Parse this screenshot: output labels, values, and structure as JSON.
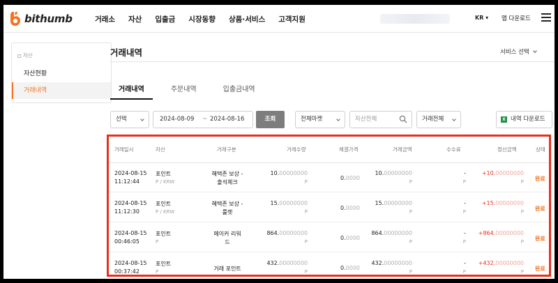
{
  "header": {
    "brand": "bithumb",
    "nav": [
      "거래소",
      "자산",
      "입출금",
      "시장동향",
      "상품·서비스",
      "고객지원"
    ],
    "lang": "KR ▾",
    "app_download": "앱 다운로드"
  },
  "colors": {
    "accent": "#f37321",
    "highlight_border": "#e5301d",
    "query_button": "#7d7d7d"
  },
  "sidebar": {
    "section": "자산",
    "items": [
      {
        "label": "자산현황",
        "active": false
      },
      {
        "label": "거래내역",
        "active": true
      }
    ]
  },
  "page": {
    "title": "거래내역",
    "service_select": "서비스 선택"
  },
  "tabs": [
    {
      "label": "거래내역",
      "active": true
    },
    {
      "label": "주문내역",
      "active": false
    },
    {
      "label": "입출금내역",
      "active": false
    }
  ],
  "filters": {
    "select": "선택",
    "date_from": "2024-08-09",
    "date_sep": "~",
    "date_to": "2024-08-16",
    "query_button": "조회",
    "market": "전체마켓",
    "asset_placeholder": "자산전체",
    "trade_type": "거래전체",
    "download_button": "내역 다운로드"
  },
  "table": {
    "headers": [
      "거래일시",
      "자산",
      "거래구분",
      "거래수량",
      "체결가격",
      "거래금액",
      "수수료",
      "정산금액",
      "상태"
    ],
    "rows": [
      {
        "date": "2024-08-15",
        "time": "11:12:44",
        "asset": "포인트",
        "asset_sub": "P / KRW",
        "type_line1": "혜택존 보상 -",
        "type_line2": "출석체크",
        "qty_int": "10.",
        "qty_dec": "00000000",
        "qty_unit": "P",
        "price_int": "0.",
        "price_dec": "0000",
        "amount_int": "10.",
        "amount_dec": "00000000",
        "amount_unit": "P",
        "fee": "-",
        "fee_unit": "P",
        "settle_int": "+10.",
        "settle_dec": "00000000",
        "settle_unit": "P",
        "status": "완료"
      },
      {
        "date": "2024-08-15",
        "time": "11:12:30",
        "asset": "포인트",
        "asset_sub": "P / KRW",
        "type_line1": "혜택존 보상 -",
        "type_line2": "룰렛",
        "qty_int": "15.",
        "qty_dec": "00000000",
        "qty_unit": "P",
        "price_int": "0.",
        "price_dec": "0000",
        "amount_int": "15.",
        "amount_dec": "00000000",
        "amount_unit": "P",
        "fee": "-",
        "fee_unit": "P",
        "settle_int": "+15.",
        "settle_dec": "00000000",
        "settle_unit": "P",
        "status": "완료"
      },
      {
        "date": "2024-08-15",
        "time": "00:46:05",
        "asset": "포인트",
        "asset_sub": "P",
        "type_line1": "메이커 리워",
        "type_line2": "드",
        "qty_int": "864.",
        "qty_dec": "00000000",
        "qty_unit": "P",
        "price_int": "0.",
        "price_dec": "0000",
        "amount_int": "864.",
        "amount_dec": "00000000",
        "amount_unit": "P",
        "fee": "-",
        "fee_unit": "P",
        "settle_int": "+864.",
        "settle_dec": "00000000",
        "settle_unit": "P",
        "status": "완료"
      },
      {
        "date": "2024-08-15",
        "time": "00:37:42",
        "asset": "포인트",
        "asset_sub": "P",
        "type_line1": "거래 포인트",
        "type_line2": "",
        "qty_int": "432.",
        "qty_dec": "00000000",
        "qty_unit": "P",
        "price_int": "0.",
        "price_dec": "0000",
        "amount_int": "432.",
        "amount_dec": "00000000",
        "amount_unit": "P",
        "fee": "-",
        "fee_unit": "P",
        "settle_int": "+432.",
        "settle_dec": "00000000",
        "settle_unit": "P",
        "status": "완료"
      }
    ]
  }
}
